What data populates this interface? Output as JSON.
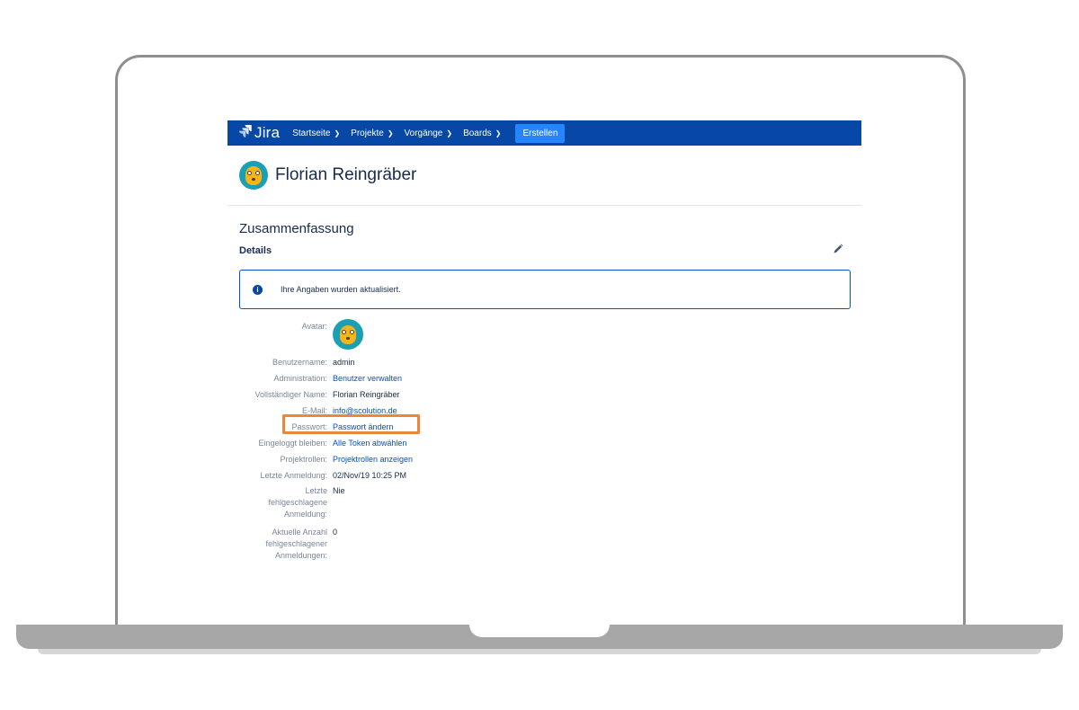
{
  "nav": {
    "logo_text": "Jira",
    "items": [
      {
        "label": "Startseite"
      },
      {
        "label": "Projekte"
      },
      {
        "label": "Vorgänge"
      },
      {
        "label": "Boards"
      }
    ],
    "create_label": "Erstellen"
  },
  "profile": {
    "name": "Florian Reingräber"
  },
  "summary": {
    "title": "Zusammenfassung",
    "details_title": "Details"
  },
  "notice": {
    "text": "Ihre Angaben wurden aktualisiert."
  },
  "details": {
    "avatar_label": "Avatar:",
    "username_label": "Benutzername:",
    "username_value": "admin",
    "admin_label": "Administration:",
    "admin_value": "Benutzer verwalten",
    "fullname_label": "Vollständiger Name:",
    "fullname_value": "Florian Reingräber",
    "email_label": "E-Mail:",
    "email_value": "info@scolution.de",
    "password_label": "Passwort:",
    "password_value": "Passwort ändern",
    "remember_label": "Eingeloggt bleiben:",
    "remember_value": "Alle Token abwählen",
    "roles_label": "Projektrollen:",
    "roles_value": "Projektrollen anzeigen",
    "lastlogin_label": "Letzte Anmeldung:",
    "lastlogin_value": "02/Nov/19 10:25 PM",
    "lastfailed_label": "Letzte fehlgeschlagene Anmeldung:",
    "lastfailed_value": "Nie",
    "failedcount_label": "Aktuelle Anzahl fehlgeschlagener Anmeldungen:",
    "failedcount_value": "0"
  },
  "colors": {
    "nav_bg": "#0747a6",
    "create_btn": "#2684ff",
    "link": "#0052cc",
    "highlight": "#e8883a"
  },
  "icons": {
    "logo": "jira-logo-icon",
    "nav_dropdown": "chevron-down-icon",
    "edit": "pencil-icon",
    "info": "info-icon",
    "avatar": "avatar-icon"
  }
}
